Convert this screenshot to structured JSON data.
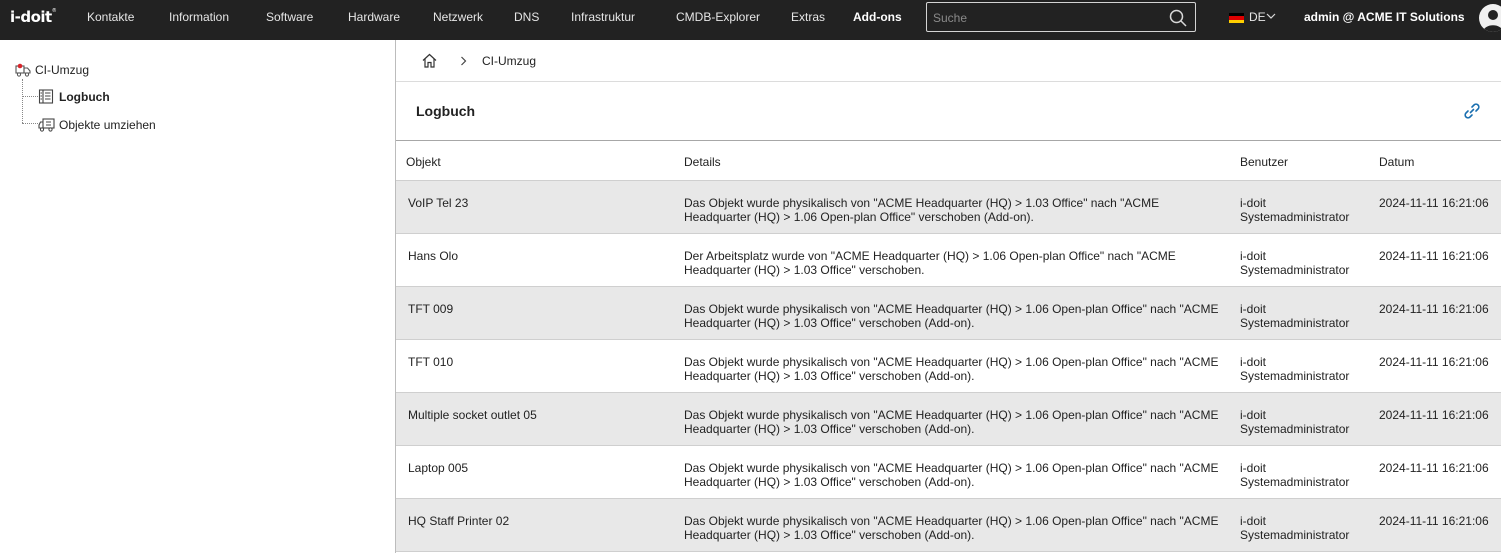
{
  "app": {
    "logo": "i-doit",
    "logo_mark": "®"
  },
  "nav": {
    "items": [
      {
        "label": "Kontakte"
      },
      {
        "label": "Information"
      },
      {
        "label": "Software"
      },
      {
        "label": "Hardware"
      },
      {
        "label": "Netzwerk"
      },
      {
        "label": "DNS"
      },
      {
        "label": "Infrastruktur"
      },
      {
        "label": "CMDB-Explorer"
      },
      {
        "label": "Extras"
      },
      {
        "label": "Add-ons",
        "active": true
      }
    ],
    "search_placeholder": "Suche",
    "search_value": "",
    "language": "DE",
    "user": "admin @ ACME IT Solutions"
  },
  "sidebar": {
    "root": {
      "label": "CI-Umzug",
      "icon": "truck-icon"
    },
    "items": [
      {
        "label": "Logbuch",
        "icon": "logbook-icon",
        "selected": true
      },
      {
        "label": "Objekte umziehen",
        "icon": "truck-icon",
        "selected": false
      }
    ]
  },
  "breadcrumb": {
    "home_icon": "home-icon",
    "items": [
      "CI-Umzug"
    ]
  },
  "page": {
    "title": "Logbuch",
    "link_icon": "link-icon"
  },
  "table": {
    "columns": [
      "Objekt",
      "Details",
      "Benutzer",
      "Datum"
    ],
    "rows": [
      {
        "objekt": "VoIP Tel 23",
        "details": "Das Objekt wurde physikalisch von \"ACME Headquarter (HQ) > 1.03 Office\" nach \"ACME Headquarter (HQ) > 1.06 Open-plan Office\" verschoben (Add-on).",
        "benutzer": "i-doit Systemadministrator",
        "datum": "2024-11-11 16:21:06"
      },
      {
        "objekt": "Hans Olo",
        "details": "Der Arbeitsplatz wurde von \"ACME Headquarter (HQ) > 1.06 Open-plan Office\" nach \"ACME Headquarter (HQ) > 1.03 Office\" verschoben.",
        "benutzer": "i-doit Systemadministrator",
        "datum": "2024-11-11 16:21:06"
      },
      {
        "objekt": "TFT 009",
        "details": "Das Objekt wurde physikalisch von \"ACME Headquarter (HQ) > 1.06 Open-plan Office\" nach \"ACME Headquarter (HQ) > 1.03 Office\" verschoben (Add-on).",
        "benutzer": "i-doit Systemadministrator",
        "datum": "2024-11-11 16:21:06"
      },
      {
        "objekt": "TFT 010",
        "details": "Das Objekt wurde physikalisch von \"ACME Headquarter (HQ) > 1.06 Open-plan Office\" nach \"ACME Headquarter (HQ) > 1.03 Office\" verschoben (Add-on).",
        "benutzer": "i-doit Systemadministrator",
        "datum": "2024-11-11 16:21:06"
      },
      {
        "objekt": "Multiple socket outlet 05",
        "details": "Das Objekt wurde physikalisch von \"ACME Headquarter (HQ) > 1.06 Open-plan Office\" nach \"ACME Headquarter (HQ) > 1.03 Office\" verschoben (Add-on).",
        "benutzer": "i-doit Systemadministrator",
        "datum": "2024-11-11 16:21:06"
      },
      {
        "objekt": "Laptop 005",
        "details": "Das Objekt wurde physikalisch von \"ACME Headquarter (HQ) > 1.06 Open-plan Office\" nach \"ACME Headquarter (HQ) > 1.03 Office\" verschoben (Add-on).",
        "benutzer": "i-doit Systemadministrator",
        "datum": "2024-11-11 16:21:06"
      },
      {
        "objekt": "HQ Staff Printer 02",
        "details": "Das Objekt wurde physikalisch von \"ACME Headquarter (HQ) > 1.06 Open-plan Office\" nach \"ACME Headquarter (HQ) > 1.03 Office\" verschoben (Add-on).",
        "benutzer": "i-doit Systemadministrator",
        "datum": "2024-11-11 16:21:06"
      }
    ]
  },
  "colors": {
    "topbar": "#222222",
    "row_alt": "#e8e8e8",
    "link_accent": "#1a6fb0",
    "flag": [
      "#000000",
      "#dd0000",
      "#ffce00"
    ]
  }
}
